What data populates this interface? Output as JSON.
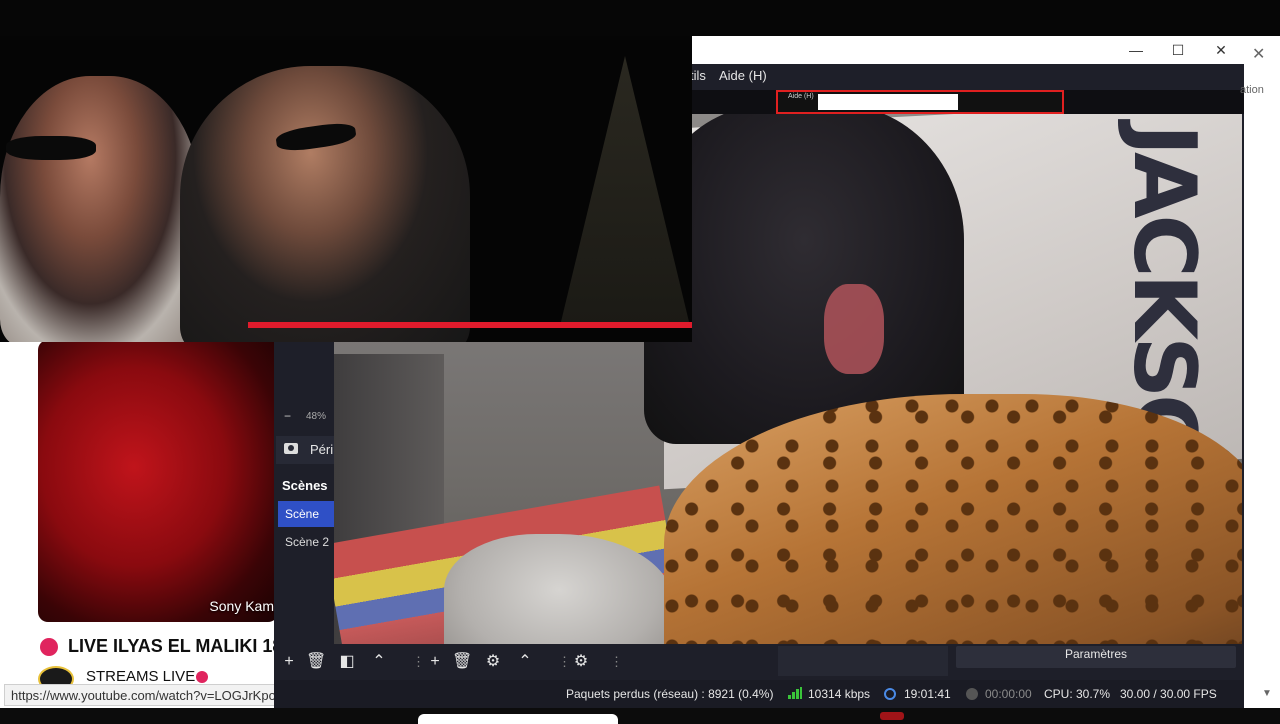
{
  "youtube": {
    "thumbnail_caption": "Sony Kam",
    "live_title": "LIVE ILYAS EL MALIKI 18",
    "channel_name": "STREAMS LIVE",
    "hover_url": "https://www.youtube.com/watch?v=LOGJrKpo"
  },
  "obs": {
    "menu": {
      "tools": "tils",
      "help": "Aide (H)"
    },
    "nested_menu_text": "Aide (H)",
    "side_text": "ation",
    "zoom_minus": "−",
    "zoom_value": "48%",
    "source_label": "Périphérique de capture vidéo",
    "scenes": {
      "title": "Scènes",
      "items": [
        {
          "label": "Scène",
          "selected": true
        },
        {
          "label": "Scène 2",
          "selected": false
        }
      ]
    },
    "settings_button": "Paramètres",
    "status": {
      "dropped_frames": "Paquets perdus (réseau) : 8921 (0.4%)",
      "bitrate": "10314 kbps",
      "stream_time": "19:01:41",
      "rec_time": "00:00:00",
      "cpu": "CPU: 30.7%",
      "fps": "30.00 / 30.00 FPS"
    },
    "colors": {
      "accent": "#2f50c6",
      "bg": "#1e1f29",
      "signal": "#3ac43a"
    }
  },
  "poster_text": "JACKSON",
  "window_controls": {
    "minimize": "—",
    "maximize": "☐",
    "close": "✕"
  },
  "toolbar_icons": [
    "plus-icon",
    "trash-icon",
    "filter-icon",
    "chevron-up-icon",
    "plus-icon",
    "trash-icon",
    "gear-icon",
    "chevron-up-icon",
    "transition-gear-icon",
    "more-icon"
  ]
}
